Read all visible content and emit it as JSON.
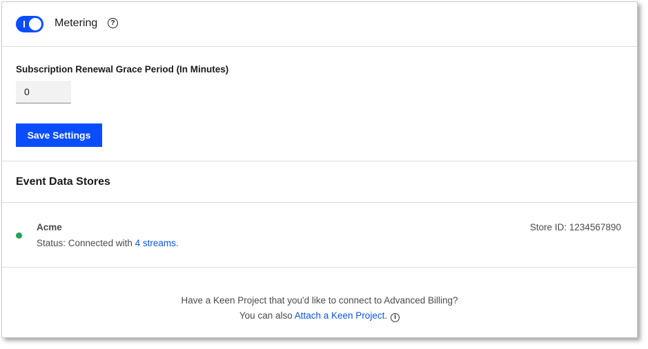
{
  "metering": {
    "label": "Metering",
    "enabled": true,
    "help_icon": "question-circle-icon",
    "help_glyph": "?"
  },
  "settings": {
    "grace_period_label": "Subscription Renewal Grace Period (In Minutes)",
    "grace_period_value": "0",
    "save_label": "Save Settings"
  },
  "event_data_stores": {
    "heading": "Event Data Stores",
    "stores": [
      {
        "name": "Acme",
        "status_prefix": "Status: Connected with",
        "streams_link": "4 streams",
        "status_suffix": ".",
        "store_id_text": "Store ID: 1234567890",
        "status_color": "#27a35a"
      }
    ]
  },
  "footer": {
    "line1": "Have a Keen Project that you'd like to connect to Advanced Billing?",
    "line2_prefix": "You can also",
    "attach_link": "Attach a Keen Project",
    "line2_suffix": ".",
    "info_icon": "info-circle-icon",
    "info_glyph": "i"
  },
  "colors": {
    "accent": "#0a4dff",
    "link": "#0a55e0",
    "connected": "#27a35a"
  }
}
